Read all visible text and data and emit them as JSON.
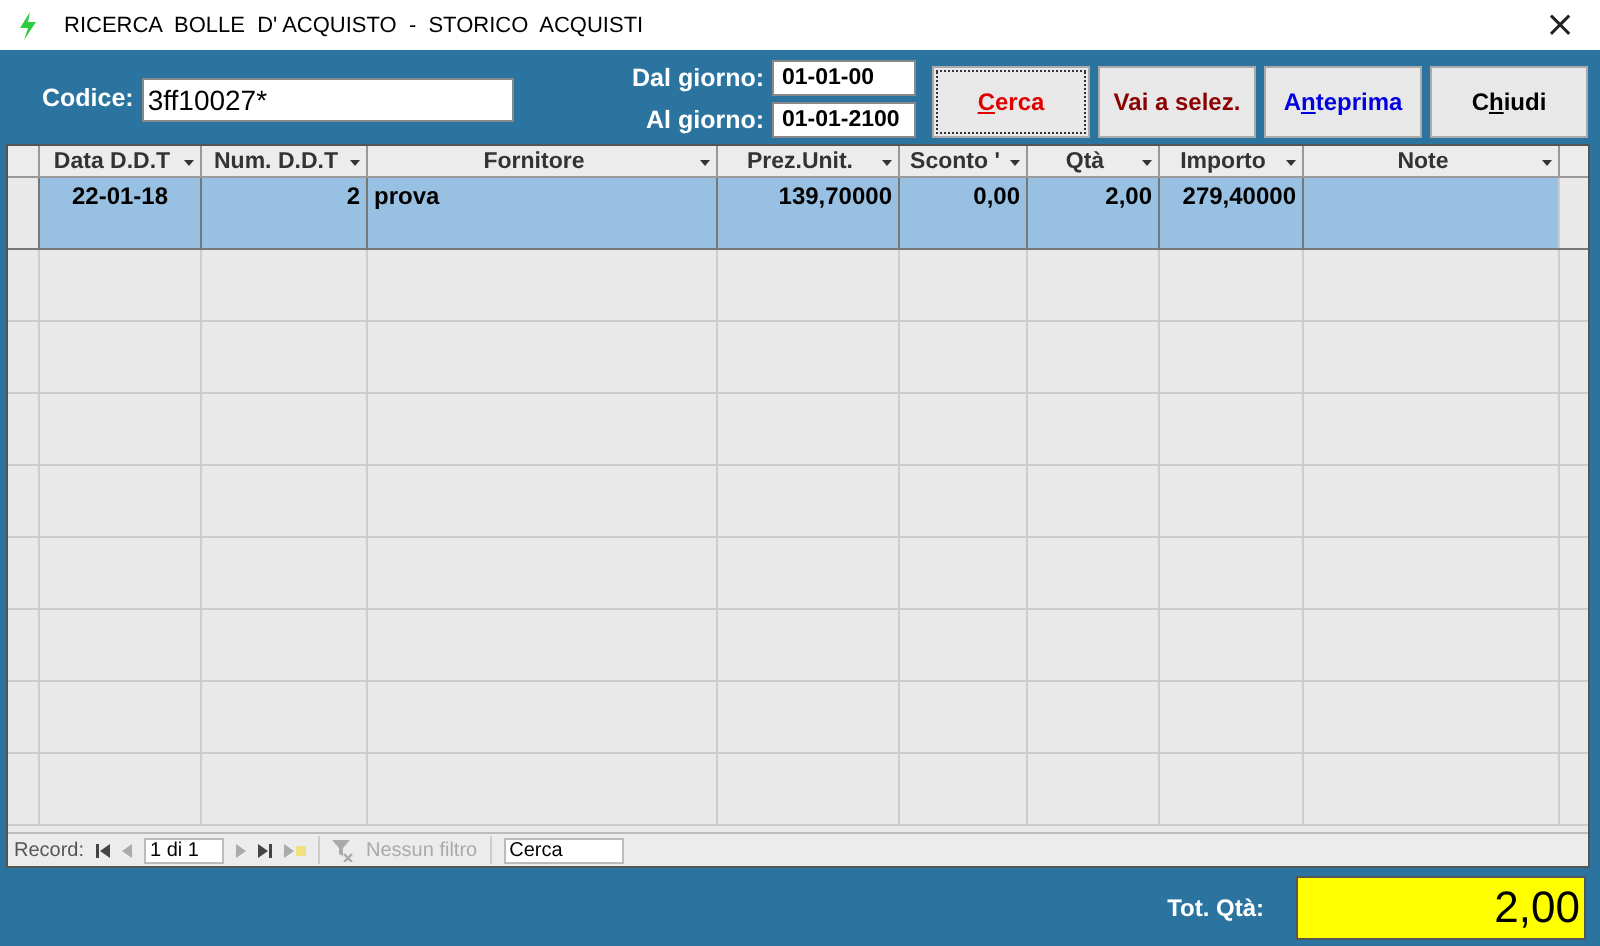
{
  "window": {
    "title": "RICERCA  BOLLE  D' ACQUISTO  -  STORICO  ACQUISTI",
    "close": "×"
  },
  "filters": {
    "code_label": "Codice:",
    "code_value": "3ff10027*",
    "from_label": "Dal giorno:",
    "from_value": "01-01-00",
    "to_label": "Al giorno:",
    "to_value": "01-01-2100"
  },
  "buttons": [
    {
      "key": "C",
      "after": "erca",
      "color": "#e00000",
      "focused": true
    },
    {
      "before": "Vai a selez.",
      "color": "#8b0000",
      "focused": false
    },
    {
      "before": "A",
      "key": "n",
      "after": "teprima",
      "color": "#0000e0",
      "focused": false
    },
    {
      "before": "C",
      "key": "h",
      "after": "iudi",
      "color": "#000000",
      "focused": false
    }
  ],
  "table": {
    "columns": [
      {
        "label": "Data D.D.T"
      },
      {
        "label": "Num. D.D.T"
      },
      {
        "label": "Fornitore"
      },
      {
        "label": "Prez.Unit."
      },
      {
        "label": "Sconto '"
      },
      {
        "label": "Qtà"
      },
      {
        "label": "Importo"
      },
      {
        "label": "Note"
      }
    ],
    "rows": [
      {
        "selected": true,
        "cells": [
          "22-01-18",
          "2",
          "prova",
          "139,70000",
          "0,00",
          "2,00",
          "279,40000",
          ""
        ]
      }
    ]
  },
  "navigator": {
    "label": "Record:",
    "position": "1 di 1",
    "filter": "Nessun filtro",
    "search": "Cerca"
  },
  "footer": {
    "label": "Tot. Qtà:",
    "value": "2,00"
  }
}
